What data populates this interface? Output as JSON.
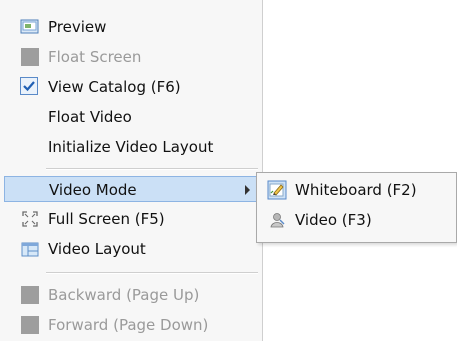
{
  "menu": {
    "items": [
      {
        "label": "Preview",
        "icon": "preview-icon",
        "enabled": true
      },
      {
        "label": "Float Screen",
        "icon": "float-screen-icon",
        "enabled": false
      },
      {
        "label": "View Catalog (F6)",
        "icon": "checkmark-icon",
        "enabled": true,
        "checked": true
      },
      {
        "label": "Float Video",
        "enabled": true
      },
      {
        "label": "Initialize Video Layout",
        "enabled": true
      },
      {
        "label": "Video Mode",
        "enabled": true,
        "has_submenu": true,
        "highlighted": true
      },
      {
        "label": "Full Screen (F5)",
        "icon": "fullscreen-icon",
        "enabled": true
      },
      {
        "label": "Video Layout",
        "icon": "video-layout-icon",
        "enabled": true
      },
      {
        "label": "Backward (Page Up)",
        "icon": "backward-icon",
        "enabled": false
      },
      {
        "label": "Forward (Page Down)",
        "icon": "forward-icon",
        "enabled": false
      }
    ]
  },
  "submenu": {
    "items": [
      {
        "label": "Whiteboard (F2)",
        "icon": "whiteboard-icon",
        "selected": true
      },
      {
        "label": "Video (F3)",
        "icon": "video-icon",
        "selected": false
      }
    ]
  },
  "colors": {
    "menu_background": "#f7f7f7",
    "highlight": "#cbe0f6",
    "highlight_border": "#8db4e3",
    "disabled_text": "#9a9a9a",
    "check_blue": "#1f5fb4"
  }
}
